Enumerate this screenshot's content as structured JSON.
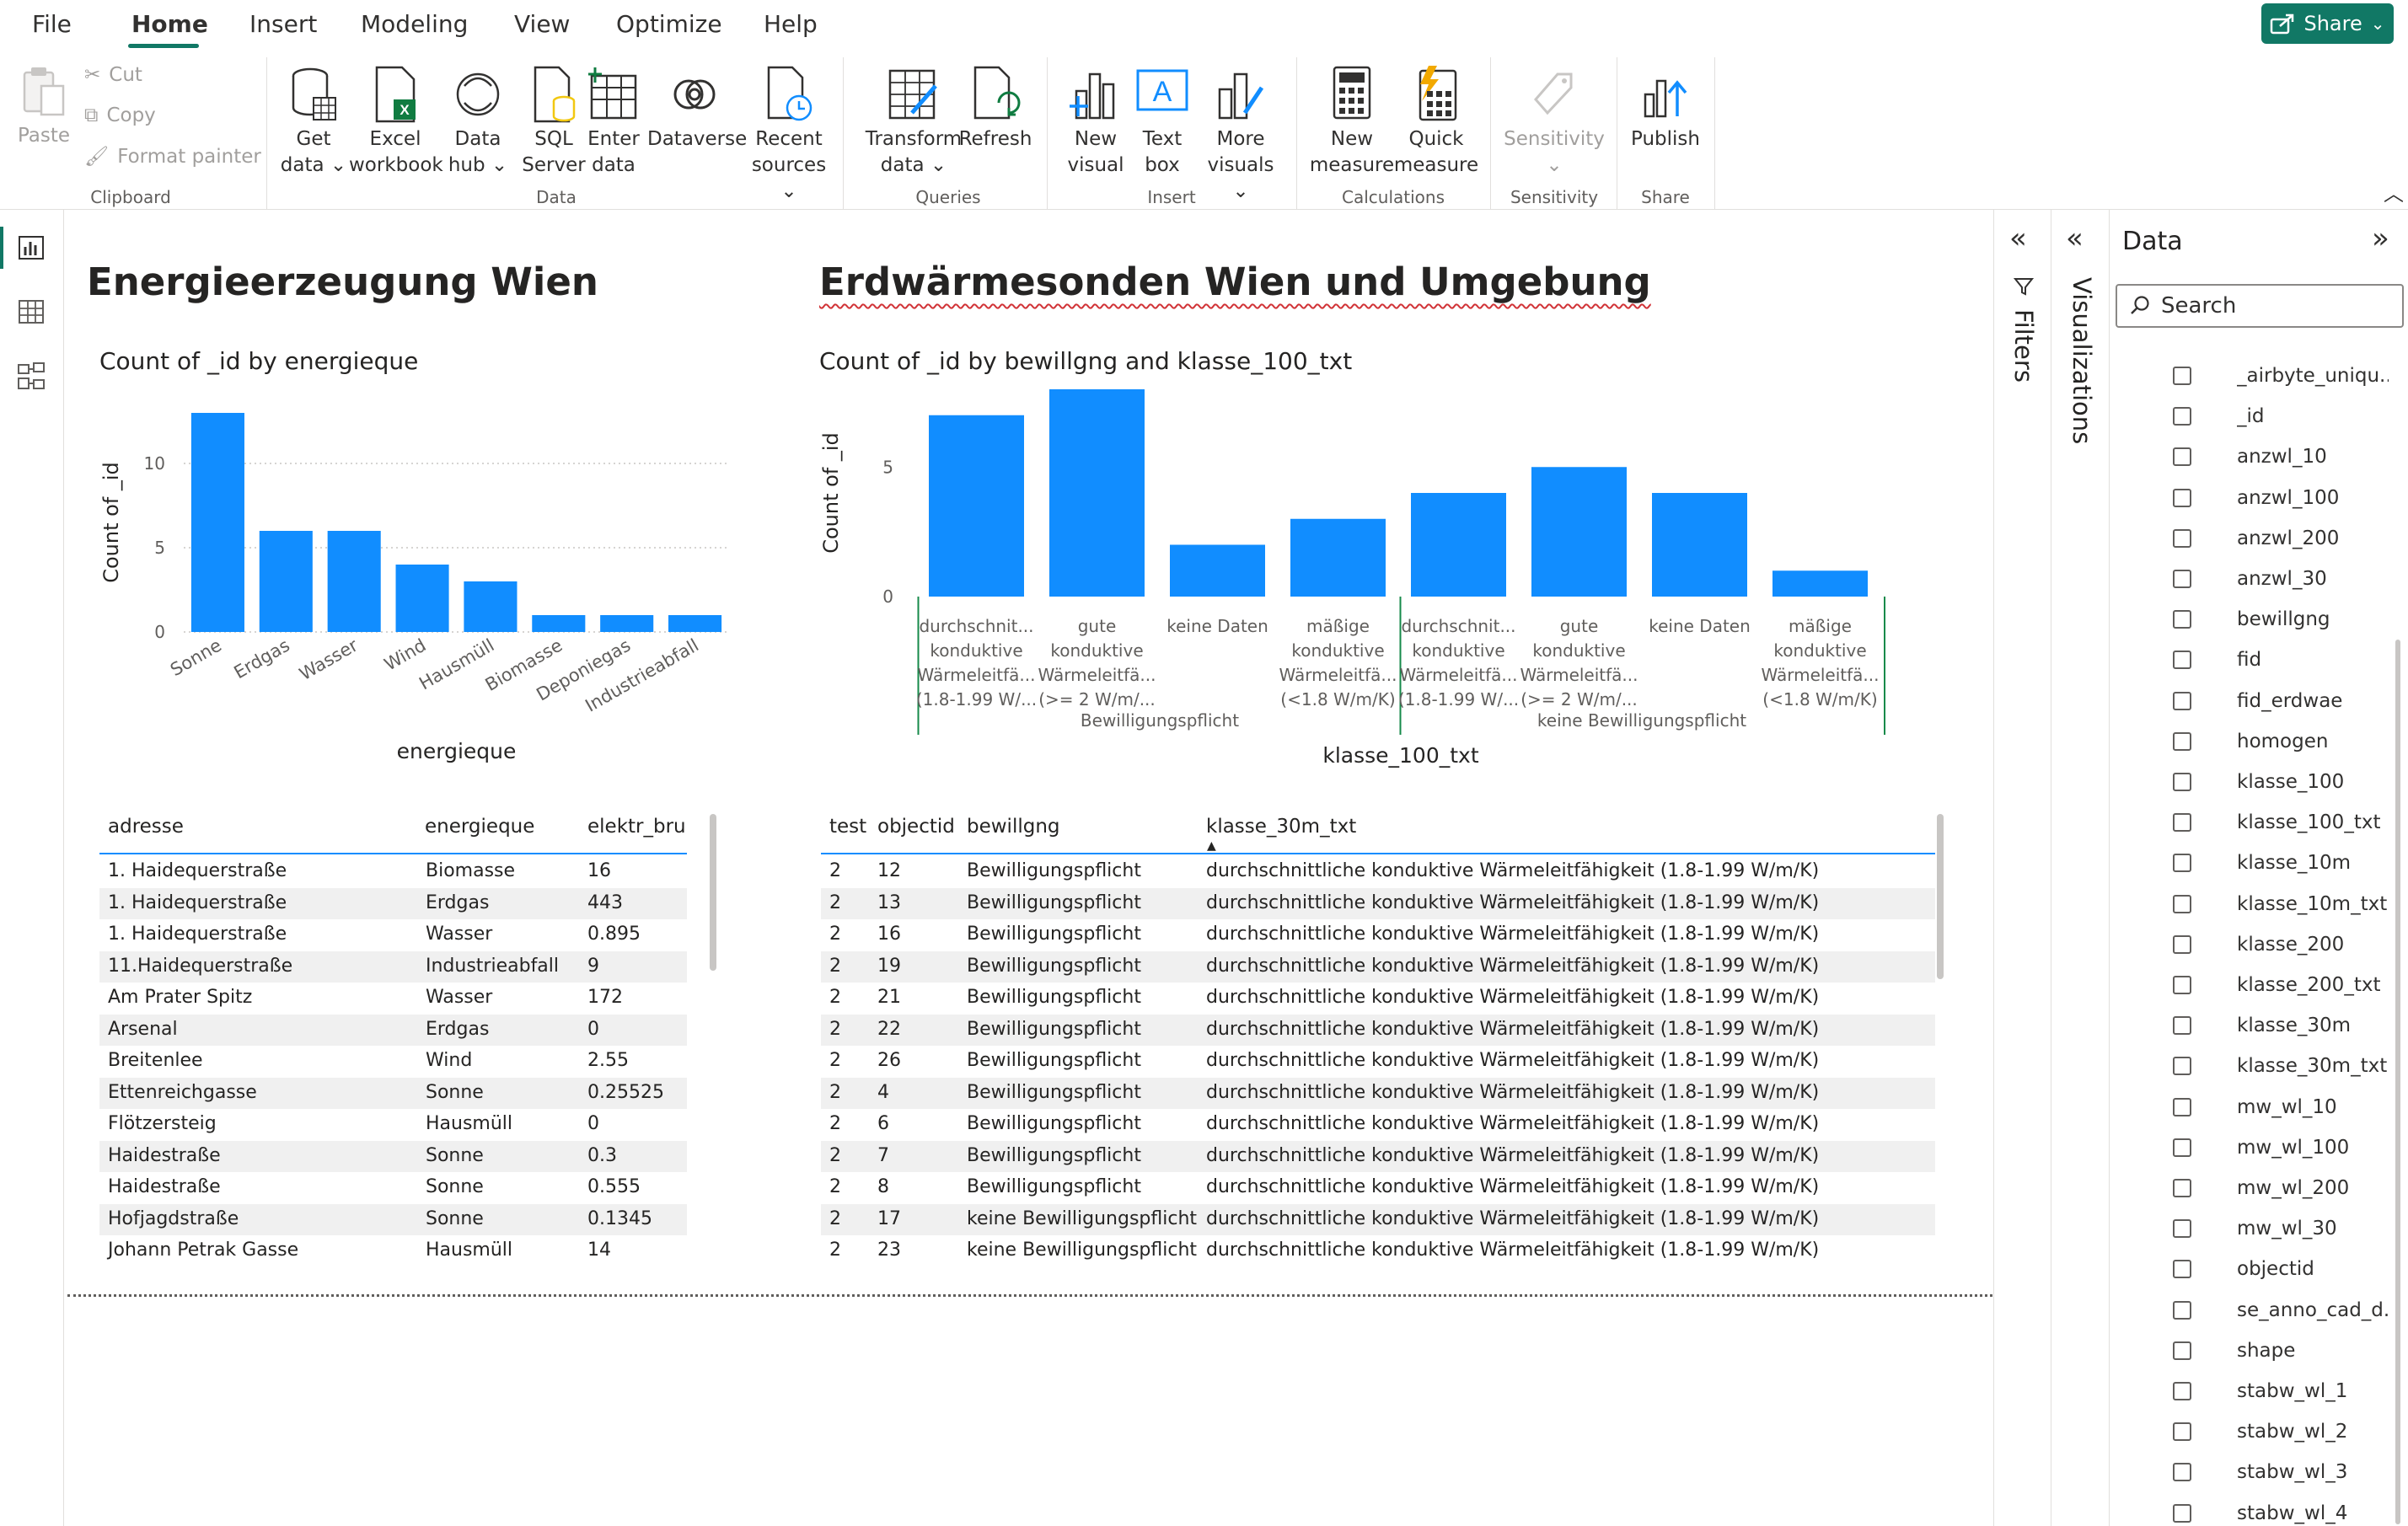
{
  "menu": {
    "tabs": [
      "File",
      "Home",
      "Insert",
      "Modeling",
      "View",
      "Optimize",
      "Help"
    ],
    "active": "Home",
    "share": "Share"
  },
  "ribbon": {
    "clipboard": {
      "paste": "Paste",
      "cut": "Cut",
      "copy": "Copy",
      "format_painter": "Format painter",
      "label": "Clipboard"
    },
    "data": {
      "get_data": [
        "Get",
        "data"
      ],
      "excel": [
        "Excel",
        "workbook"
      ],
      "data_hub": [
        "Data",
        "hub"
      ],
      "sql": [
        "SQL",
        "Server"
      ],
      "enter": [
        "Enter",
        "data"
      ],
      "dataverse": "Dataverse",
      "recent": [
        "Recent",
        "sources"
      ],
      "label": "Data"
    },
    "queries": {
      "transform": [
        "Transform",
        "data"
      ],
      "refresh": "Refresh",
      "label": "Queries"
    },
    "insert": {
      "new_visual": [
        "New",
        "visual"
      ],
      "text_box": [
        "Text",
        "box"
      ],
      "more_visuals": [
        "More",
        "visuals"
      ],
      "label": "Insert"
    },
    "calculations": {
      "new_measure": [
        "New",
        "measure"
      ],
      "quick_measure": [
        "Quick",
        "measure"
      ],
      "label": "Calculations"
    },
    "sensitivity": {
      "btn": "Sensitivity",
      "label": "Sensitivity"
    },
    "share": {
      "publish": "Publish",
      "label": "Share"
    }
  },
  "left": {
    "title": "Energieerzeugung Wien",
    "chart_title": "Count of _id by energieque"
  },
  "right": {
    "title": "Erdwärmesonden Wien und Umgebung",
    "chart_title": "Count of _id by bewillgng and klasse_100_txt"
  },
  "chart_data": [
    {
      "type": "bar",
      "title": "Count of _id by energieque",
      "xlabel": "energieque",
      "ylabel": "Count of _id",
      "categories": [
        "Sonne",
        "Erdgas",
        "Wasser",
        "Wind",
        "Hausmüll",
        "Biomasse",
        "Deponiegas",
        "Industrieabfall"
      ],
      "values": [
        13,
        6,
        6,
        4,
        3,
        1,
        1,
        1
      ],
      "ylim": [
        0,
        13
      ],
      "yticks": [
        0,
        5,
        10
      ],
      "grid": true
    },
    {
      "type": "bar",
      "title": "Count of _id by bewillgng and klasse_100_txt",
      "xlabel": "klasse_100_txt",
      "ylabel": "Count of _id",
      "groups": [
        {
          "name": "Bewilligungspflicht",
          "categories": [
            [
              "durchschnit...",
              "konduktive",
              "Wärmeleitfä...",
              "(1.8-1.99 W/..."
            ],
            [
              "gute",
              "konduktive",
              "Wärmeleitfä...",
              "(>= 2 W/m/..."
            ],
            [
              "keine Daten"
            ],
            [
              "mäßige",
              "konduktive",
              "Wärmeleitfä...",
              "(<1.8 W/m/K)"
            ]
          ],
          "values": [
            7,
            8,
            2,
            3
          ]
        },
        {
          "name": "keine Bewilligungspflicht",
          "categories": [
            [
              "durchschnit...",
              "konduktive",
              "Wärmeleitfä...",
              "(1.8-1.99 W/..."
            ],
            [
              "gute",
              "konduktive",
              "Wärmeleitfä...",
              "(>= 2 W/m/..."
            ],
            [
              "keine Daten"
            ],
            [
              "mäßige",
              "konduktive",
              "Wärmeleitfä...",
              "(<1.8 W/m/K)"
            ]
          ],
          "values": [
            4,
            5,
            4,
            1
          ]
        }
      ],
      "ylim": [
        0,
        8
      ],
      "yticks": [
        0,
        5
      ],
      "grid": true
    }
  ],
  "table1": {
    "headers": [
      "adresse",
      "energieque",
      "elektr_bru"
    ],
    "rows": [
      [
        "1. Haidequerstraße",
        "Biomasse",
        "16"
      ],
      [
        "1. Haidequerstraße",
        "Erdgas",
        "443"
      ],
      [
        "1. Haidequerstraße",
        "Wasser",
        "0.895"
      ],
      [
        "11.Haidequerstraße",
        "Industrieabfall",
        "9"
      ],
      [
        "Am Prater Spitz",
        "Wasser",
        "172"
      ],
      [
        "Arsenal",
        "Erdgas",
        "0"
      ],
      [
        "Breitenlee",
        "Wind",
        "2.55"
      ],
      [
        "Ettenreichgasse",
        "Sonne",
        "0.25525"
      ],
      [
        "Flötzersteig",
        "Hausmüll",
        "0"
      ],
      [
        "Haidestraße",
        "Sonne",
        "0.3"
      ],
      [
        "Haidestraße",
        "Sonne",
        "0.555"
      ],
      [
        "Hofjagdstraße",
        "Sonne",
        "0.1345"
      ],
      [
        "Johann Petrak Gasse",
        "Hausmüll",
        "14"
      ]
    ]
  },
  "table2": {
    "headers": [
      "test",
      "objectid",
      "bewillgng",
      "klasse_30m_txt"
    ],
    "rows": [
      [
        "2",
        "12",
        "Bewilligungspflicht",
        "durchschnittliche konduktive Wärmeleitfähigkeit (1.8-1.99 W/m/K)"
      ],
      [
        "2",
        "13",
        "Bewilligungspflicht",
        "durchschnittliche konduktive Wärmeleitfähigkeit (1.8-1.99 W/m/K)"
      ],
      [
        "2",
        "16",
        "Bewilligungspflicht",
        "durchschnittliche konduktive Wärmeleitfähigkeit (1.8-1.99 W/m/K)"
      ],
      [
        "2",
        "19",
        "Bewilligungspflicht",
        "durchschnittliche konduktive Wärmeleitfähigkeit (1.8-1.99 W/m/K)"
      ],
      [
        "2",
        "21",
        "Bewilligungspflicht",
        "durchschnittliche konduktive Wärmeleitfähigkeit (1.8-1.99 W/m/K)"
      ],
      [
        "2",
        "22",
        "Bewilligungspflicht",
        "durchschnittliche konduktive Wärmeleitfähigkeit (1.8-1.99 W/m/K)"
      ],
      [
        "2",
        "26",
        "Bewilligungspflicht",
        "durchschnittliche konduktive Wärmeleitfähigkeit (1.8-1.99 W/m/K)"
      ],
      [
        "2",
        "4",
        "Bewilligungspflicht",
        "durchschnittliche konduktive Wärmeleitfähigkeit (1.8-1.99 W/m/K)"
      ],
      [
        "2",
        "6",
        "Bewilligungspflicht",
        "durchschnittliche konduktive Wärmeleitfähigkeit (1.8-1.99 W/m/K)"
      ],
      [
        "2",
        "7",
        "Bewilligungspflicht",
        "durchschnittliche konduktive Wärmeleitfähigkeit (1.8-1.99 W/m/K)"
      ],
      [
        "2",
        "8",
        "Bewilligungspflicht",
        "durchschnittliche konduktive Wärmeleitfähigkeit (1.8-1.99 W/m/K)"
      ],
      [
        "2",
        "17",
        "keine Bewilligungspflicht",
        "durchschnittliche konduktive Wärmeleitfähigkeit (1.8-1.99 W/m/K)"
      ],
      [
        "2",
        "23",
        "keine Bewilligungspflicht",
        "durchschnittliche konduktive Wärmeleitfähigkeit (1.8-1.99 W/m/K)"
      ]
    ]
  },
  "panes": {
    "filters": "Filters",
    "visualizations": "Visualizations",
    "data_title": "Data",
    "search_placeholder": "Search"
  },
  "fields": [
    "_airbyte_uniqu...",
    "_id",
    "anzwl_10",
    "anzwl_100",
    "anzwl_200",
    "anzwl_30",
    "bewillgng",
    "fid",
    "fid_erdwae",
    "homogen",
    "klasse_100",
    "klasse_100_txt",
    "klasse_10m",
    "klasse_10m_txt",
    "klasse_200",
    "klasse_200_txt",
    "klasse_30m",
    "klasse_30m_txt",
    "mw_wl_10",
    "mw_wl_100",
    "mw_wl_200",
    "mw_wl_30",
    "objectid",
    "se_anno_cad_d...",
    "shape",
    "stabw_wl_1",
    "stabw_wl_2",
    "stabw_wl_3",
    "stabw_wl_4"
  ],
  "colors": {
    "bar": "#118dff",
    "accent": "#117865",
    "divider": "#168a4a"
  }
}
